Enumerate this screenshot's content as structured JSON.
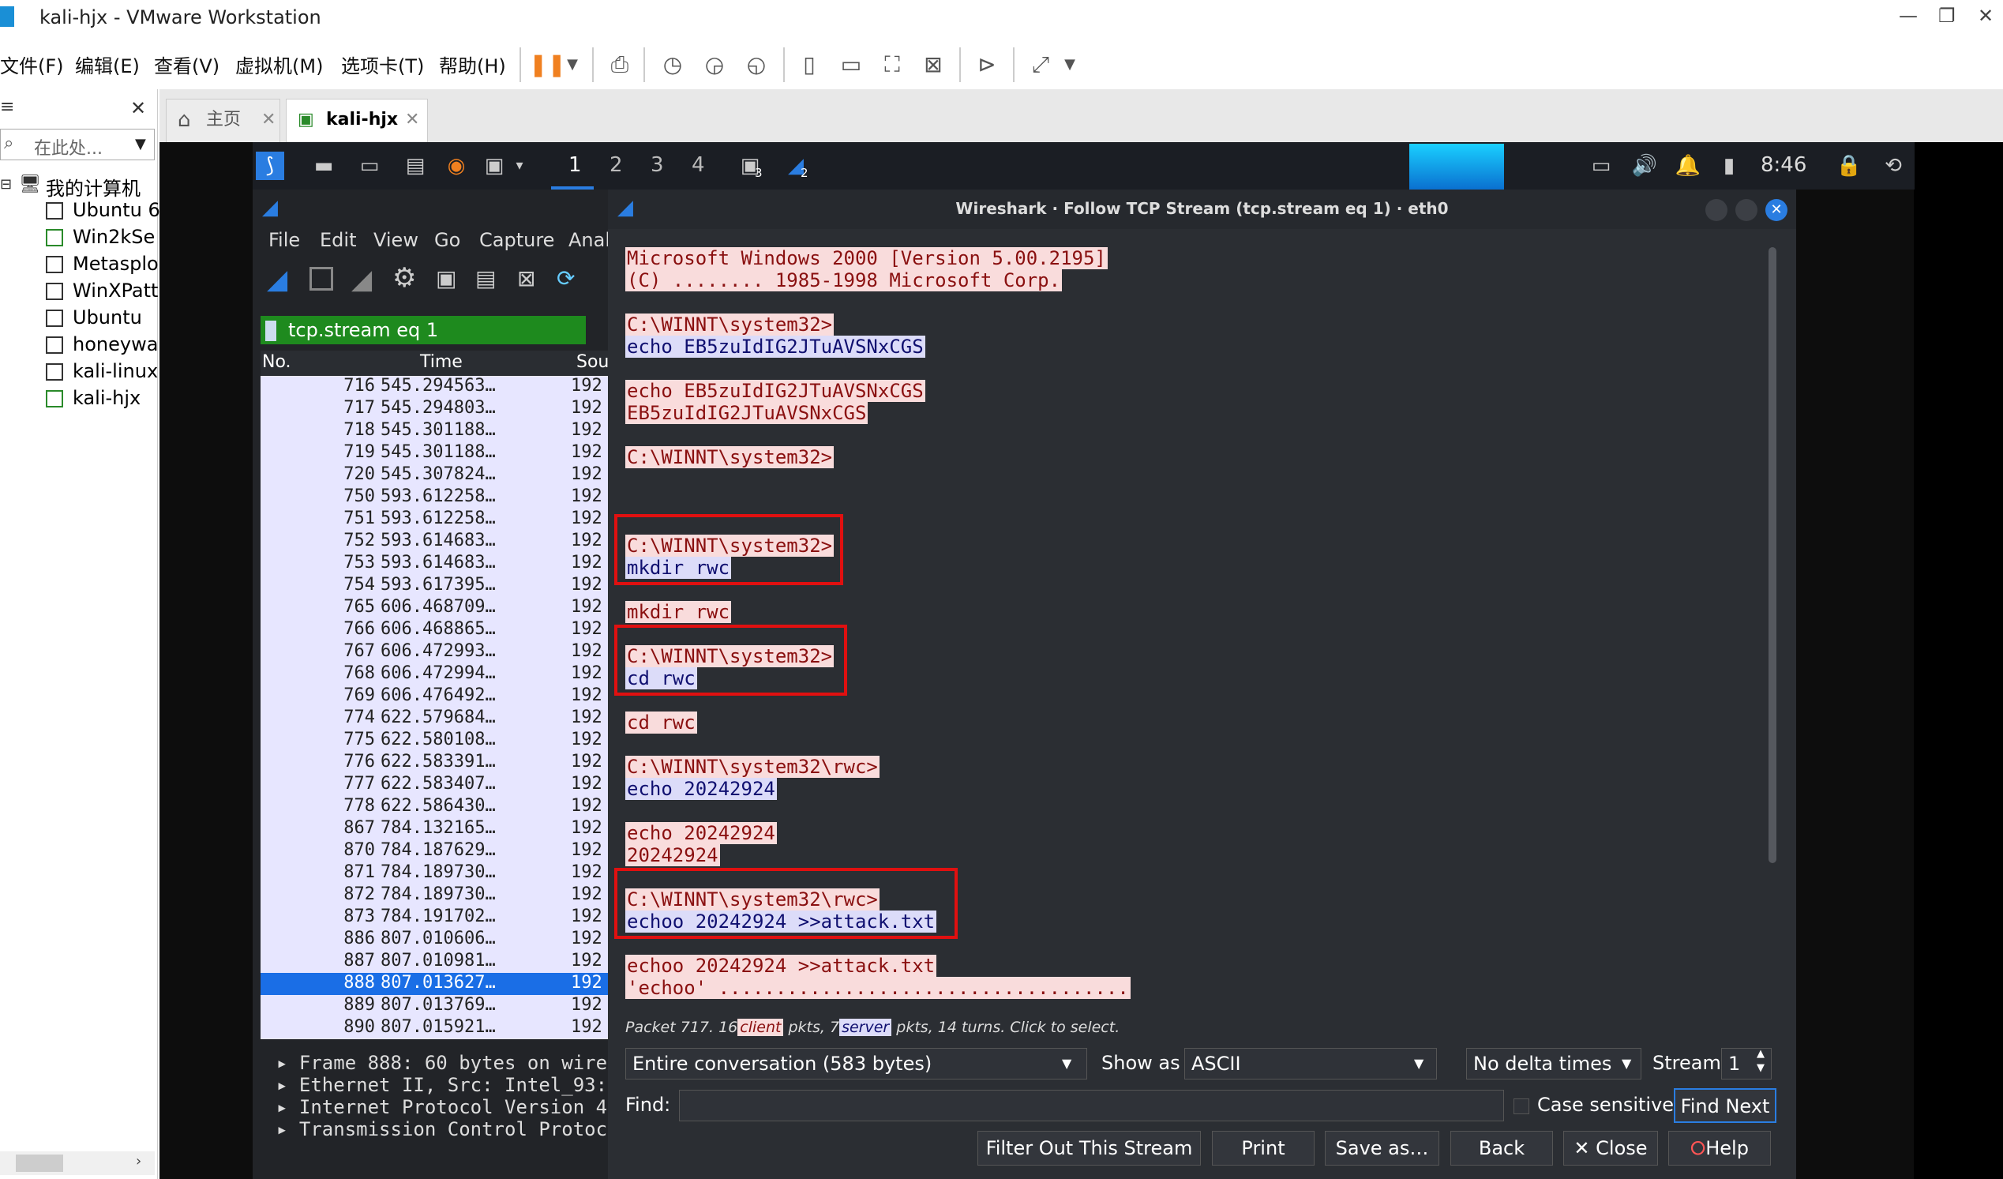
{
  "window": {
    "title": "kali-hjx - VMware Workstation",
    "minimize": "—",
    "restore": "❐",
    "close": "✕"
  },
  "menu": [
    "文件(F)",
    "编辑(E)",
    "查看(V)",
    "虚拟机(M)",
    "选项卡(T)",
    "帮助(H)"
  ],
  "library": {
    "close": "✕",
    "search_placeholder": "在此处...",
    "root": "我的计算机",
    "items": [
      "Ubuntu 6",
      "Win2kSe",
      "Metasplo",
      "WinXPatt",
      "Ubuntu",
      "honeywa",
      "kali-linux",
      "kali-hjx"
    ]
  },
  "tabs": [
    {
      "label": "主页"
    },
    {
      "label": "kali-hjx"
    }
  ],
  "kali": {
    "workspaces": [
      "1",
      "2",
      "3",
      "4"
    ],
    "clock": "8:46",
    "badge_term": "3",
    "badge_ws": "2"
  },
  "wireshark": {
    "menu": [
      "File",
      "Edit",
      "View",
      "Go",
      "Capture",
      "Anal"
    ],
    "filter": "tcp.stream eq 1",
    "columns": [
      "No.",
      "Time",
      "Sour"
    ],
    "packets": [
      {
        "no": "716",
        "time": "545.294563…",
        "src": "192"
      },
      {
        "no": "717",
        "time": "545.294803…",
        "src": "192"
      },
      {
        "no": "718",
        "time": "545.301188…",
        "src": "192"
      },
      {
        "no": "719",
        "time": "545.301188…",
        "src": "192"
      },
      {
        "no": "720",
        "time": "545.307824…",
        "src": "192"
      },
      {
        "no": "750",
        "time": "593.612258…",
        "src": "192"
      },
      {
        "no": "751",
        "time": "593.612258…",
        "src": "192"
      },
      {
        "no": "752",
        "time": "593.614683…",
        "src": "192"
      },
      {
        "no": "753",
        "time": "593.614683…",
        "src": "192"
      },
      {
        "no": "754",
        "time": "593.617395…",
        "src": "192"
      },
      {
        "no": "765",
        "time": "606.468709…",
        "src": "192"
      },
      {
        "no": "766",
        "time": "606.468865…",
        "src": "192"
      },
      {
        "no": "767",
        "time": "606.472993…",
        "src": "192"
      },
      {
        "no": "768",
        "time": "606.472994…",
        "src": "192"
      },
      {
        "no": "769",
        "time": "606.476492…",
        "src": "192"
      },
      {
        "no": "774",
        "time": "622.579684…",
        "src": "192"
      },
      {
        "no": "775",
        "time": "622.580108…",
        "src": "192"
      },
      {
        "no": "776",
        "time": "622.583391…",
        "src": "192"
      },
      {
        "no": "777",
        "time": "622.583407…",
        "src": "192"
      },
      {
        "no": "778",
        "time": "622.586430…",
        "src": "192"
      },
      {
        "no": "867",
        "time": "784.132165…",
        "src": "192"
      },
      {
        "no": "870",
        "time": "784.187629…",
        "src": "192"
      },
      {
        "no": "871",
        "time": "784.189730…",
        "src": "192"
      },
      {
        "no": "872",
        "time": "784.189730…",
        "src": "192"
      },
      {
        "no": "873",
        "time": "784.191702…",
        "src": "192"
      },
      {
        "no": "886",
        "time": "807.010606…",
        "src": "192"
      },
      {
        "no": "887",
        "time": "807.010981…",
        "src": "192"
      },
      {
        "no": "888",
        "time": "807.013627…",
        "src": "192",
        "selected": true
      },
      {
        "no": "889",
        "time": "807.013769…",
        "src": "192"
      },
      {
        "no": "890",
        "time": "807.015921…",
        "src": "192"
      }
    ],
    "details": [
      "Frame 888: 60 bytes on wire",
      "Ethernet II, Src: Intel_93:",
      "Internet Protocol Version 4",
      "Transmission Control Protoc"
    ]
  },
  "dialog": {
    "title": "Wireshark · Follow TCP Stream (tcp.stream eq 1) · eth0",
    "stream": [
      {
        "who": "client",
        "text": "Microsoft Windows 2000 [Version 5.00.2195]"
      },
      {
        "who": "client",
        "text": "(C) ........ 1985-1998 Microsoft Corp."
      },
      {
        "who": "client",
        "text": "C:\\WINNT\\system32>"
      },
      {
        "who": "server",
        "text": "echo EB5zuIdIG2JTuAVSNxCGS"
      },
      {
        "who": "client",
        "text": "echo EB5zuIdIG2JTuAVSNxCGS"
      },
      {
        "who": "client",
        "text": "EB5zuIdIG2JTuAVSNxCGS"
      },
      {
        "who": "client",
        "text": "C:\\WINNT\\system32>"
      },
      {
        "who": "client",
        "text": "C:\\WINNT\\system32>"
      },
      {
        "who": "server",
        "text": "mkdir rwc"
      },
      {
        "who": "client",
        "text": "mkdir rwc"
      },
      {
        "who": "client",
        "text": "C:\\WINNT\\system32>"
      },
      {
        "who": "server",
        "text": "cd rwc"
      },
      {
        "who": "client",
        "text": "cd rwc"
      },
      {
        "who": "client",
        "text": "C:\\WINNT\\system32\\rwc>"
      },
      {
        "who": "server",
        "text": "echo 20242924"
      },
      {
        "who": "client",
        "text": "echo 20242924"
      },
      {
        "who": "client",
        "text": "20242924"
      },
      {
        "who": "client",
        "text": "C:\\WINNT\\system32\\rwc>"
      },
      {
        "who": "server",
        "text": "echoo 20242924 >>attack.txt"
      },
      {
        "who": "client",
        "text": "echoo 20242924 >>attack.txt"
      },
      {
        "who": "client",
        "text": "'echoo' ...................................."
      }
    ],
    "status": {
      "prefix": "Packet 717. 16",
      "client": "client",
      "mid": "pkts, 7",
      "server": "server",
      "suffix": "pkts, 14 turns. Click to select."
    },
    "conversation": "Entire conversation (583 bytes)",
    "show_as_label": "Show as",
    "show_as": "ASCII",
    "delta": "No delta times",
    "stream_label": "Stream",
    "stream_value": "1",
    "find_label": "Find:",
    "case_sensitive": "Case sensitive",
    "find_next": "Find Next",
    "buttons": {
      "filter_out": "Filter Out This Stream",
      "print": "Print",
      "save_as": "Save as…",
      "back": "Back",
      "close": "Close",
      "help": "Help"
    }
  }
}
